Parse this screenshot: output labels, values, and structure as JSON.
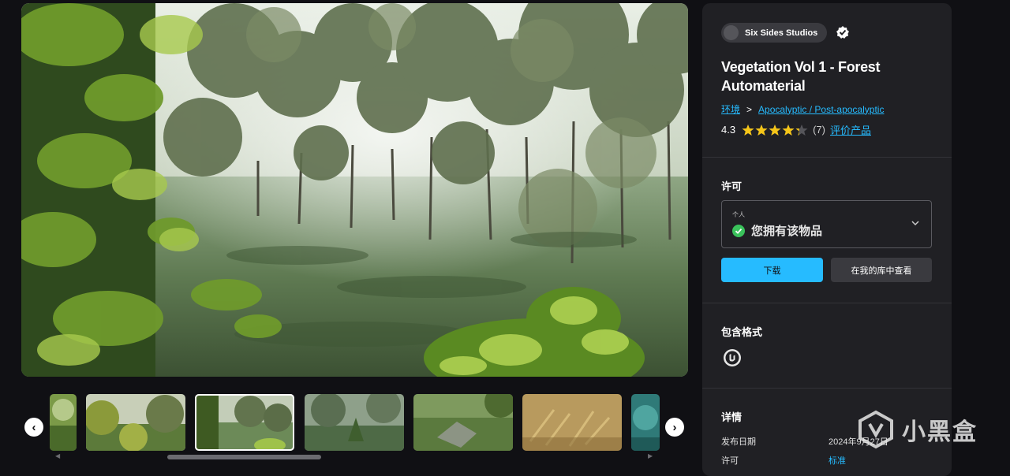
{
  "gallery": {
    "prev_icon": "chevron-left-icon",
    "next_icon": "chevron-right-icon",
    "prev_glyph": "‹",
    "next_glyph": "›",
    "scroll_left_glyph": "◀",
    "scroll_right_glyph": "▶",
    "selected_index": 2
  },
  "product": {
    "seller": "Six Sides Studios",
    "verified_icon": "verified-badge-icon",
    "title": "Vegetation Vol 1 - Forest Automaterial",
    "breadcrumb": [
      "环境",
      "Apocalyptic / Post-apocalyptic"
    ],
    "breadcrumb_separator": ">",
    "rating": "4.3",
    "rating_value": 4.3,
    "rating_max": 5,
    "review_count": "(7)",
    "rate_link": "评价产品"
  },
  "license": {
    "heading": "许可",
    "type_label": "个人",
    "status": "您拥有该物品",
    "download_button": "下载",
    "library_button": "在我的库中查看"
  },
  "formats": {
    "heading": "包含格式",
    "engine_icon": "unreal-engine-icon"
  },
  "details": {
    "heading": "详情",
    "rows": [
      {
        "label": "发布日期",
        "value": "2024年9月27日"
      },
      {
        "label": "许可",
        "value": "标准"
      }
    ]
  },
  "watermark": {
    "text": "小黑盒"
  },
  "colors": {
    "accent": "#26bbff",
    "background": "#101014",
    "panel": "#202024",
    "star": "#f5c518",
    "owned_check": "#3ac25b"
  }
}
